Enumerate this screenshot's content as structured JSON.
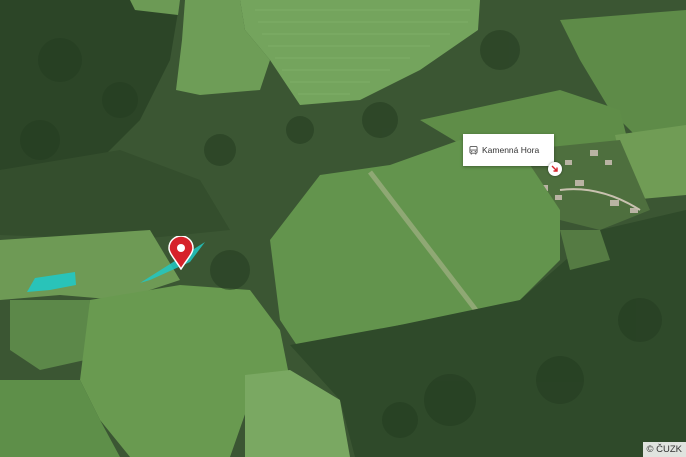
{
  "map": {
    "type": "aerial orthophoto",
    "place_label": "Kamenná Hora",
    "place_icon": "bus-stop-icon",
    "location_pin_icon": "map-pin-icon",
    "parcel_highlight_color": "#21c8c4",
    "pin_color": "#d6222a",
    "attribution": "© ČUZK"
  }
}
